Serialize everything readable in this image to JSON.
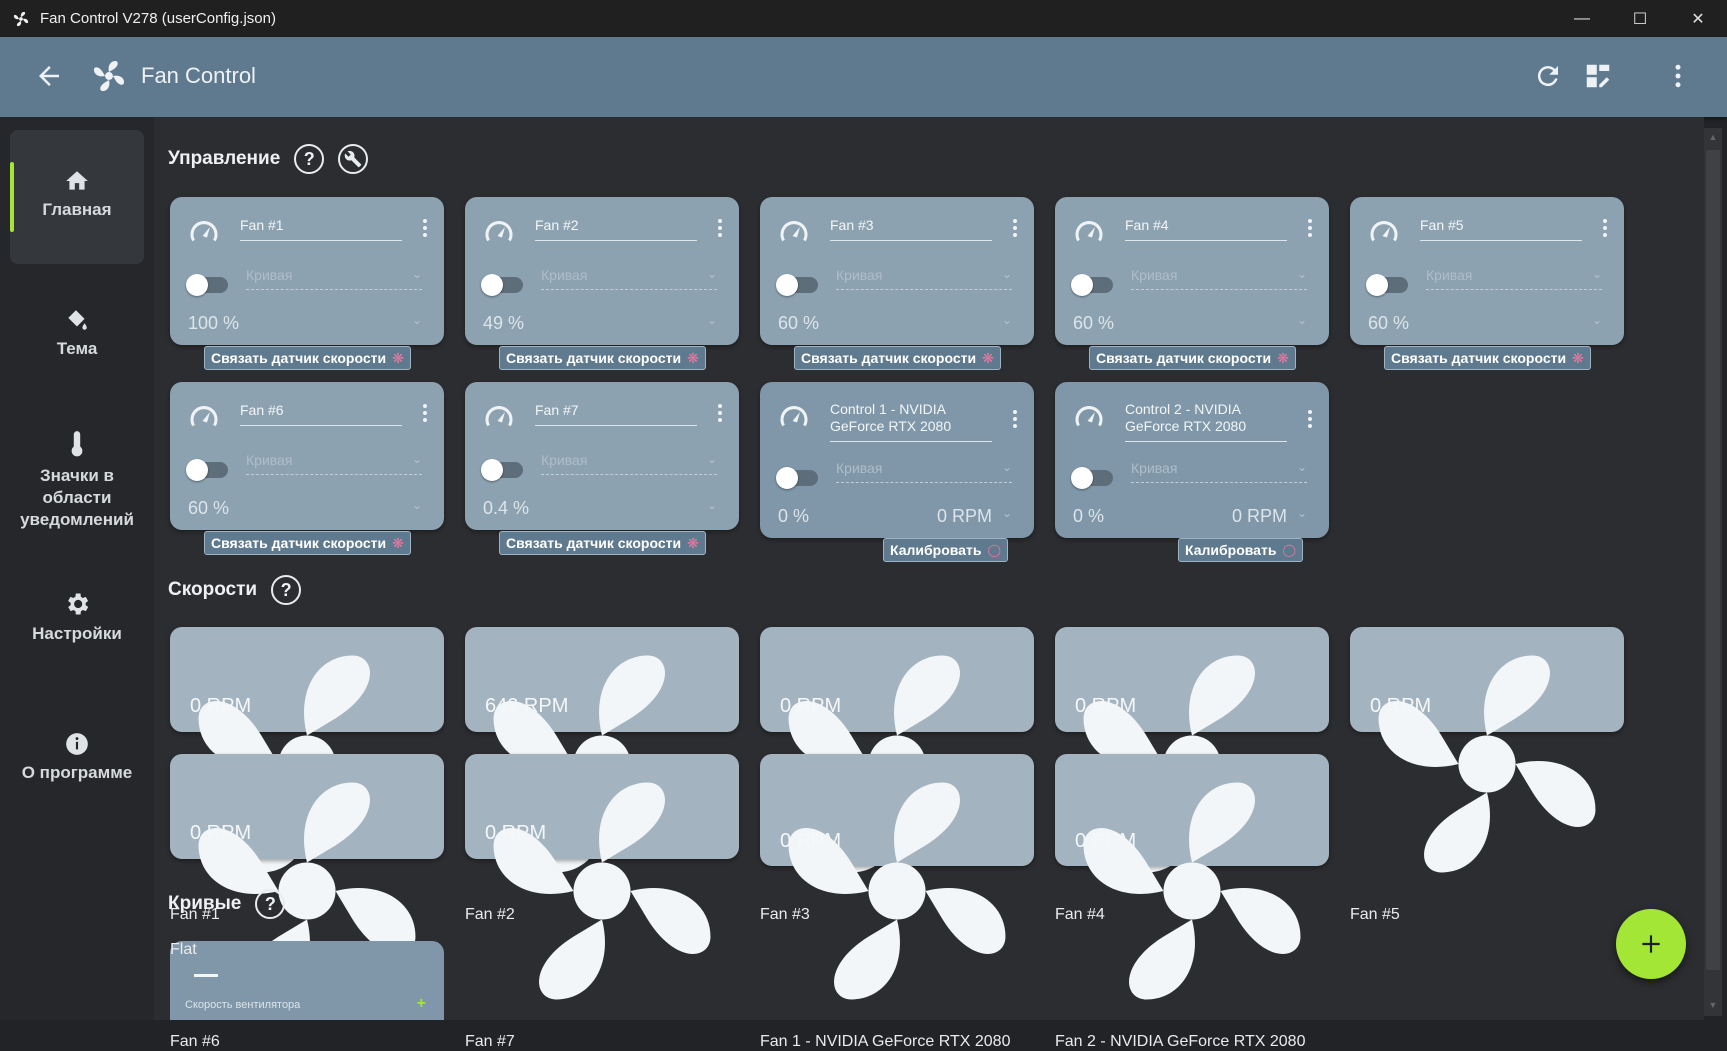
{
  "window": {
    "title": "Fan Control V278 (userConfig.json)"
  },
  "appbar": {
    "title": "Fan Control"
  },
  "sidebar": {
    "items": [
      {
        "label": "Главная",
        "icon": "home-icon",
        "active": true
      },
      {
        "label": "Тема",
        "icon": "paint-bucket-icon",
        "active": false
      },
      {
        "label": "Значки в области уведомлений",
        "icon": "thermometer-icon",
        "active": false
      },
      {
        "label": "Настройки",
        "icon": "gear-icon",
        "active": false
      },
      {
        "label": "О программе",
        "icon": "info-icon",
        "active": false
      }
    ]
  },
  "sections": {
    "controls": "Управление",
    "speeds": "Скорости",
    "curves": "Кривые"
  },
  "controls": [
    {
      "name": "Fan #1",
      "curve": "Кривая",
      "value": "100 %",
      "rpm": "",
      "button": "Связать датчик скорости"
    },
    {
      "name": "Fan #2",
      "curve": "Кривая",
      "value": "49 %",
      "rpm": "",
      "button": "Связать датчик скорости"
    },
    {
      "name": "Fan #3",
      "curve": "Кривая",
      "value": "60 %",
      "rpm": "",
      "button": "Связать датчик скорости"
    },
    {
      "name": "Fan #4",
      "curve": "Кривая",
      "value": "60 %",
      "rpm": "",
      "button": "Связать датчик скорости"
    },
    {
      "name": "Fan #5",
      "curve": "Кривая",
      "value": "60 %",
      "rpm": "",
      "button": "Связать датчик скорости"
    },
    {
      "name": "Fan #6",
      "curve": "Кривая",
      "value": "60 %",
      "rpm": "",
      "button": "Связать датчик скорости"
    },
    {
      "name": "Fan #7",
      "curve": "Кривая",
      "value": "0.4 %",
      "rpm": "",
      "button": "Связать датчик скорости"
    },
    {
      "name": "Control 1 - NVIDIA GeForce RTX 2080",
      "curve": "Кривая",
      "value": "0 %",
      "rpm": "0 RPM",
      "button": "Калибровать"
    },
    {
      "name": "Control 2 - NVIDIA GeForce RTX 2080",
      "curve": "Кривая",
      "value": "0 %",
      "rpm": "0 RPM",
      "button": "Калибровать"
    }
  ],
  "speeds": [
    {
      "name": "Fan #1",
      "rpm": "0 RPM"
    },
    {
      "name": "Fan #2",
      "rpm": "642 RPM"
    },
    {
      "name": "Fan #3",
      "rpm": "0 RPM"
    },
    {
      "name": "Fan #4",
      "rpm": "0 RPM"
    },
    {
      "name": "Fan #5",
      "rpm": "0 RPM"
    },
    {
      "name": "Fan #6",
      "rpm": "0 RPM"
    },
    {
      "name": "Fan #7",
      "rpm": "0 RPM"
    },
    {
      "name": "Fan 1 - NVIDIA GeForce RTX 2080",
      "rpm": "0 RPM"
    },
    {
      "name": "Fan 2 - NVIDIA GeForce RTX 2080",
      "rpm": "0 RPM"
    }
  ],
  "curves": [
    {
      "name": "Flat",
      "sub": "Скорость вентилятора"
    }
  ],
  "colors": {
    "accent": "#a3e635",
    "appbar": "#5f7a8f",
    "card": "#8da2b1",
    "link_icon": "#e879a0"
  }
}
